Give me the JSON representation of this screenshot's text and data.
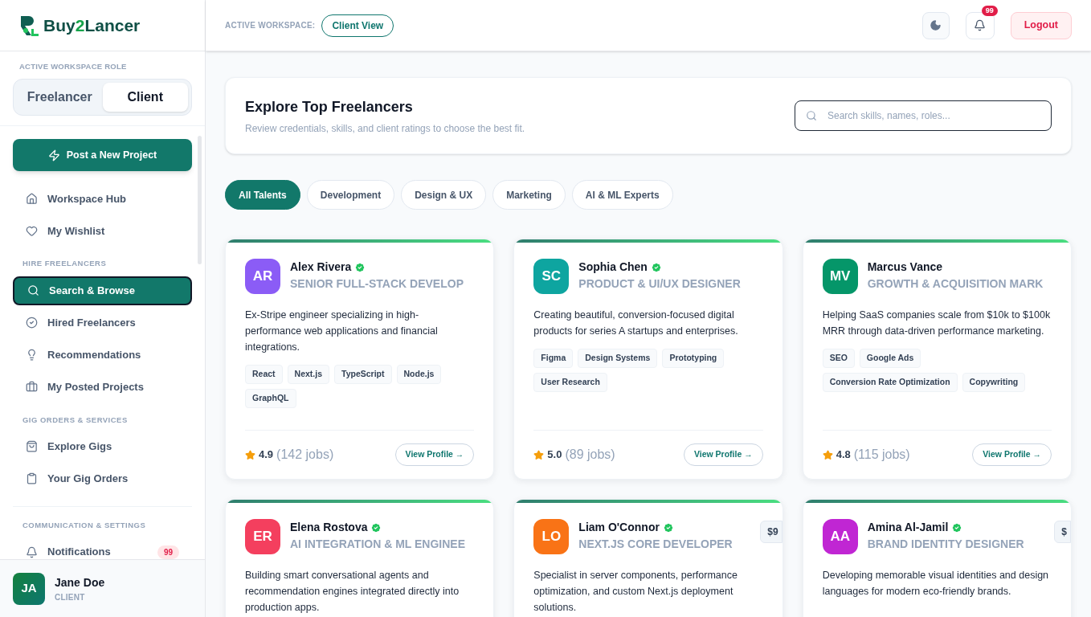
{
  "brand": {
    "before": "Buy",
    "accent": "2",
    "after": "Lancer"
  },
  "role_switch": {
    "label": "ACTIVE WORKSPACE ROLE",
    "options": [
      {
        "label": "Freelancer",
        "selected": false
      },
      {
        "label": "Client",
        "selected": true
      }
    ]
  },
  "post_button": "Post a New Project",
  "nav": [
    {
      "kind": "item",
      "label": "Workspace Hub",
      "selected": false
    },
    {
      "kind": "item",
      "label": "My Wishlist",
      "selected": false
    },
    {
      "kind": "section",
      "label": "HIRE FREELANCERS"
    },
    {
      "kind": "item",
      "label": "Search & Browse",
      "selected": true
    },
    {
      "kind": "item",
      "label": "Hired Freelancers",
      "selected": false
    },
    {
      "kind": "item",
      "label": "Recommendations",
      "selected": false
    },
    {
      "kind": "item",
      "label": "My Posted Projects",
      "selected": false
    },
    {
      "kind": "section",
      "label": "GIG ORDERS & SERVICES"
    },
    {
      "kind": "item",
      "label": "Explore Gigs",
      "selected": false
    },
    {
      "kind": "item",
      "label": "Your Gig Orders",
      "selected": false
    },
    {
      "kind": "divider"
    },
    {
      "kind": "section",
      "label": "COMMUNICATION & SETTINGS"
    },
    {
      "kind": "item",
      "label": "Notifications",
      "selected": false,
      "badge": "99"
    }
  ],
  "user": {
    "initials": "JA",
    "name": "Jane Doe",
    "role": "CLIENT"
  },
  "header": {
    "workspace_label": "ACTIVE WORKSPACE:",
    "workspace_value": "Client View",
    "notification_count": "99",
    "logout": "Logout"
  },
  "explore": {
    "title": "Explore Top Freelancers",
    "subtitle": "Review credentials, skills, and client ratings to choose the best fit.",
    "search_placeholder": "Search skills, names, roles..."
  },
  "filters": [
    {
      "label": "All Talents",
      "selected": true
    },
    {
      "label": "Development",
      "selected": false
    },
    {
      "label": "Design & UX",
      "selected": false
    },
    {
      "label": "Marketing",
      "selected": false
    },
    {
      "label": "AI & ML Experts",
      "selected": false
    }
  ],
  "freelancers": [
    {
      "initials": "AR",
      "color": "#8b5cf6",
      "name": "Alex Rivera",
      "verified": true,
      "title": "SENIOR FULL-STACK DEVELOP",
      "bio": "Ex-Stripe engineer specializing in high-performance web applications and financial integrations.",
      "skills": [
        "React",
        "Next.js",
        "TypeScript",
        "Node.js",
        "GraphQL"
      ],
      "rating": "4.9",
      "jobs": "(142 jobs)",
      "action": "View Profile →"
    },
    {
      "initials": "SC",
      "color": "#0ea5a0",
      "name": "Sophia Chen",
      "verified": true,
      "title": "PRODUCT & UI/UX DESIGNER",
      "bio": "Creating beautiful, conversion-focused digital products for series A startups and enterprises.",
      "skills": [
        "Figma",
        "Design Systems",
        "Prototyping",
        "User Research"
      ],
      "rating": "5.0",
      "jobs": "(89 jobs)",
      "action": "View Profile →"
    },
    {
      "initials": "MV",
      "color": "#059669",
      "name": "Marcus Vance",
      "verified": false,
      "title": "GROWTH & ACQUISITION MARK",
      "bio": "Helping SaaS companies scale from $10k to $100k MRR through data-driven performance marketing.",
      "skills": [
        "SEO",
        "Google Ads",
        "Conversion Rate Optimization",
        "Copywriting"
      ],
      "rating": "4.8",
      "jobs": "(115 jobs)",
      "action": "View Profile →"
    },
    {
      "initials": "ER",
      "color": "#f43f5e",
      "name": "Elena Rostova",
      "verified": true,
      "title": "AI INTEGRATION & ML ENGINEE",
      "bio": "Building smart conversational agents and recommendation engines integrated directly into production apps."
    },
    {
      "initials": "LO",
      "color": "#f97316",
      "name": "Liam O'Connor",
      "verified": true,
      "title": "NEXT.JS CORE DEVELOPER",
      "price": "$9",
      "bio": "Specialist in server components, performance optimization, and custom Next.js deployment solutions."
    },
    {
      "initials": "AA",
      "color": "#c026d3",
      "name": "Amina Al-Jamil",
      "verified": true,
      "title": "BRAND IDENTITY DESIGNER",
      "price": "$",
      "bio": "Developing memorable visual identities and design languages for modern eco-friendly brands."
    }
  ]
}
